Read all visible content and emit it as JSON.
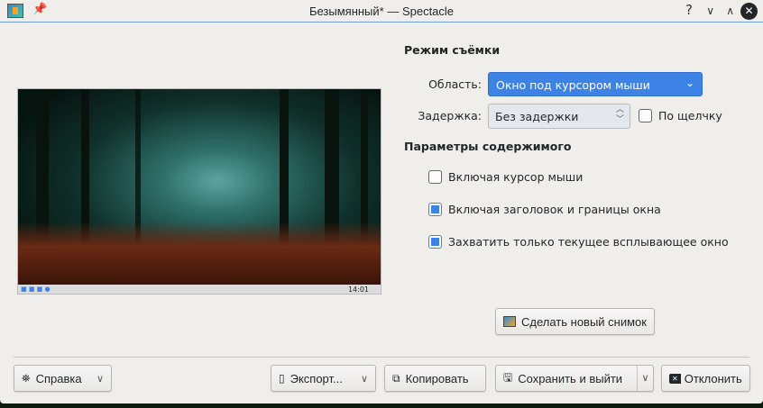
{
  "window": {
    "title": "Безымянный* — Spectacle",
    "help": "?",
    "minimize": "∨",
    "maximize": "∧",
    "close": "✕"
  },
  "preview": {
    "taskbar_time": "14:01"
  },
  "capture_mode": {
    "heading": "Режим съёмки",
    "area_label": "Область:",
    "area_value": "Окно под курсором мыши",
    "delay_label": "Задержка:",
    "delay_value": "Без задержки",
    "on_click_label": "По щелчку",
    "on_click_checked": false
  },
  "content_options": {
    "heading": "Параметры содержимого",
    "options": [
      {
        "label": "Включая курсор мыши",
        "checked": false
      },
      {
        "label": "Включая заголовок и границы окна",
        "checked": true
      },
      {
        "label": "Захватить только текущее всплывающее окно",
        "checked": true
      }
    ]
  },
  "buttons": {
    "new_screenshot": "Сделать новый снимок",
    "help": "Справка",
    "export": "Экспорт...",
    "copy": "Копировать",
    "save_exit": "Сохранить и выйти",
    "discard": "Отклонить"
  },
  "colors": {
    "accent": "#3d83e6"
  }
}
